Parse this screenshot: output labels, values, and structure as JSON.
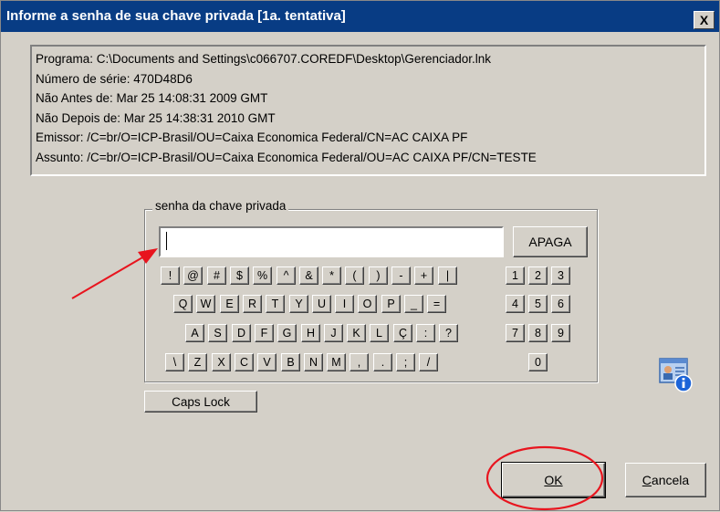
{
  "title": "Informe a senha de sua chave privada [1a. tentativa]",
  "close_label": "X",
  "info_lines": [
    "Programa: C:\\Documents and Settings\\c066707.COREDF\\Desktop\\Gerenciador.lnk",
    "Número de série: 470D48D6",
    "Não Antes de: Mar 25 14:08:31 2009 GMT",
    "Não Depois de: Mar 25 14:38:31 2010 GMT",
    "Emissor: /C=br/O=ICP-Brasil/OU=Caixa Economica Federal/CN=AC CAIXA PF",
    "Assunto: /C=br/O=ICP-Brasil/OU=Caixa Economica Federal/OU=AC CAIXA PF/CN=TESTE"
  ],
  "group_label": "senha da chave privada",
  "password_value": "",
  "apaga_label": "APAGA",
  "keys": {
    "row1": [
      "!",
      "@",
      "#",
      "$",
      "%",
      "^",
      "&",
      "*",
      "(",
      ")",
      "-",
      "+",
      "|"
    ],
    "row2": [
      "Q",
      "W",
      "E",
      "R",
      "T",
      "Y",
      "U",
      "I",
      "O",
      "P",
      "_",
      "="
    ],
    "row3": [
      "A",
      "S",
      "D",
      "F",
      "G",
      "H",
      "J",
      "K",
      "L",
      "Ç",
      ":",
      "?"
    ],
    "row4": [
      "\\",
      "Z",
      "X",
      "C",
      "V",
      "B",
      "N",
      "M",
      ",",
      ".",
      ";",
      "/"
    ],
    "digits": [
      "1",
      "2",
      "3",
      "4",
      "5",
      "6",
      "7",
      "8",
      "9",
      "0"
    ]
  },
  "caps_label": "Caps Lock",
  "ok_label": "OK",
  "cancel_label_first": "C",
  "cancel_label_rest": "ancela",
  "colors": {
    "titlebar": "#083c84",
    "dialog_bg": "#d4d0c8",
    "annotation_red": "#e8141e"
  }
}
